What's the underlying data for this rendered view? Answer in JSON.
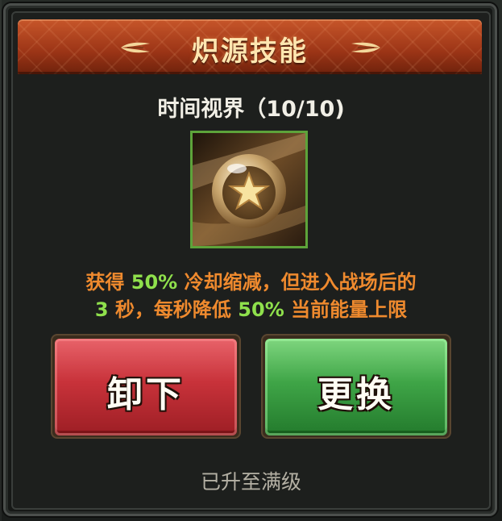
{
  "panel": {
    "title": "炽源技能",
    "skill_name": "时间视界（10/10)",
    "skill_icon": "star-orb-icon",
    "description": {
      "seg1": "获得",
      "seg2": "50%",
      "seg3": "冷却缩减，但进入战场后的",
      "seg4": "3",
      "seg5": "秒，每秒降低",
      "seg6": "50%",
      "seg7": "当前能量上限"
    },
    "buttons": {
      "unequip": "卸下",
      "replace": "更换"
    },
    "footer": "已升至满级"
  },
  "colors": {
    "title_bar": "#9b3416",
    "description_text": "#ef8a2e",
    "highlight_text": "#8fe04c",
    "unequip_button": "#c8323a",
    "replace_button": "#3fa547",
    "icon_border": "#5da33a"
  }
}
